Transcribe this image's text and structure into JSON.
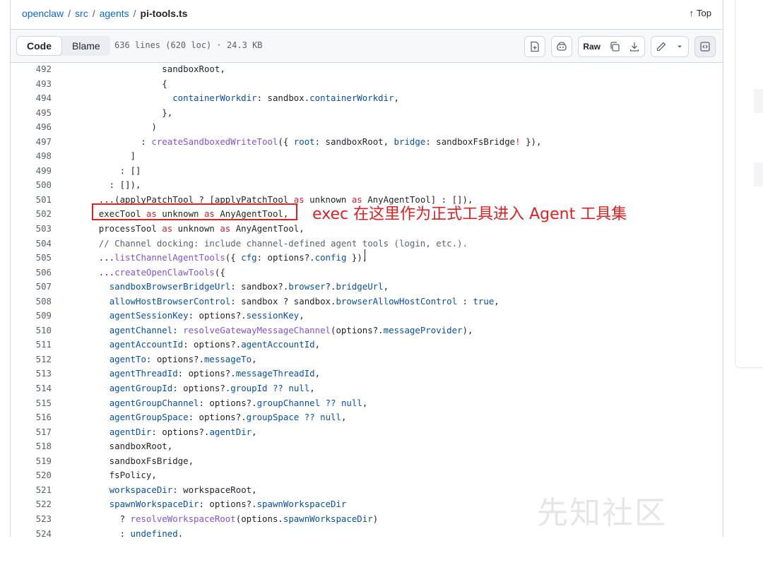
{
  "breadcrumb": {
    "repo": "openclaw",
    "src": "src",
    "agents": "agents",
    "file": "pi-tools.ts",
    "separator": "/"
  },
  "top_link": {
    "arrow": "↑",
    "label": "Top"
  },
  "toolbar": {
    "code_tab": "Code",
    "blame_tab": "Blame",
    "file_info": "636 lines (620 loc) · 24.3 KB",
    "raw_label": "Raw"
  },
  "icons": [
    "file-plus-icon",
    "copilot-icon",
    "copy-icon",
    "download-icon",
    "pencil-icon",
    "chevron-down-icon",
    "symbols-icon",
    "arrow-up-icon"
  ],
  "lines": [
    {
      "n": "492",
      "segs": [
        [
          "t",
          "                  sandboxRoot,"
        ]
      ]
    },
    {
      "n": "493",
      "segs": [
        [
          "t",
          "                  {"
        ]
      ]
    },
    {
      "n": "494",
      "segs": [
        [
          "t",
          "                    "
        ],
        [
          "p",
          "containerWorkdir"
        ],
        [
          "t",
          ": sandbox."
        ],
        [
          "p",
          "containerWorkdir"
        ],
        [
          "t",
          ","
        ]
      ]
    },
    {
      "n": "495",
      "segs": [
        [
          "t",
          "                  },"
        ]
      ]
    },
    {
      "n": "496",
      "segs": [
        [
          "t",
          "                )"
        ]
      ]
    },
    {
      "n": "497",
      "segs": [
        [
          "t",
          "              : "
        ],
        [
          "f",
          "createSandboxedWriteTool"
        ],
        [
          "t",
          "({ "
        ],
        [
          "p",
          "root"
        ],
        [
          "t",
          ": sandboxRoot, "
        ],
        [
          "p",
          "bridge"
        ],
        [
          "t",
          ": sandboxFsBridge"
        ],
        [
          "k",
          "!"
        ],
        [
          "t",
          " }),"
        ]
      ]
    },
    {
      "n": "498",
      "segs": [
        [
          "t",
          "            ]"
        ]
      ]
    },
    {
      "n": "499",
      "segs": [
        [
          "t",
          "          : []"
        ]
      ]
    },
    {
      "n": "500",
      "segs": [
        [
          "t",
          "        : []),"
        ]
      ]
    },
    {
      "n": "501",
      "segs": [
        [
          "t",
          "      ...(applyPatchTool ? [applyPatchTool "
        ],
        [
          "k",
          "as"
        ],
        [
          "t",
          " unknown "
        ],
        [
          "k",
          "as"
        ],
        [
          "t",
          " AnyAgentTool] : []),"
        ]
      ]
    },
    {
      "n": "502",
      "segs": [
        [
          "t",
          "      execTool "
        ],
        [
          "k",
          "as"
        ],
        [
          "t",
          " unknown "
        ],
        [
          "k",
          "as"
        ],
        [
          "t",
          " AnyAgentTool,"
        ]
      ]
    },
    {
      "n": "503",
      "segs": [
        [
          "t",
          "      processTool "
        ],
        [
          "k",
          "as"
        ],
        [
          "t",
          " unknown "
        ],
        [
          "k",
          "as"
        ],
        [
          "t",
          " AnyAgentTool,"
        ]
      ]
    },
    {
      "n": "504",
      "segs": [
        [
          "c",
          "      // Channel docking: include channel-defined agent tools (login, etc.)."
        ]
      ]
    },
    {
      "n": "505",
      "segs": [
        [
          "t",
          "      ..."
        ],
        [
          "f",
          "listChannelAgentTools"
        ],
        [
          "t",
          "({ "
        ],
        [
          "p",
          "cfg"
        ],
        [
          "t",
          ": options?."
        ],
        [
          "p",
          "config"
        ],
        [
          "t",
          " }),"
        ]
      ]
    },
    {
      "n": "506",
      "segs": [
        [
          "t",
          "      ..."
        ],
        [
          "f",
          "createOpenClawTools"
        ],
        [
          "t",
          "({"
        ]
      ]
    },
    {
      "n": "507",
      "segs": [
        [
          "t",
          "        "
        ],
        [
          "p",
          "sandboxBrowserBridgeUrl"
        ],
        [
          "t",
          ": sandbox?."
        ],
        [
          "p",
          "browser"
        ],
        [
          "t",
          "?."
        ],
        [
          "p",
          "bridgeUrl"
        ],
        [
          "t",
          ","
        ]
      ]
    },
    {
      "n": "508",
      "segs": [
        [
          "t",
          "        "
        ],
        [
          "p",
          "allowHostBrowserControl"
        ],
        [
          "t",
          ": sandbox ? sandbox."
        ],
        [
          "p",
          "browserAllowHostControl"
        ],
        [
          "t",
          " : "
        ],
        [
          "p",
          "true"
        ],
        [
          "t",
          ","
        ]
      ]
    },
    {
      "n": "509",
      "segs": [
        [
          "t",
          "        "
        ],
        [
          "p",
          "agentSessionKey"
        ],
        [
          "t",
          ": options?."
        ],
        [
          "p",
          "sessionKey"
        ],
        [
          "t",
          ","
        ]
      ]
    },
    {
      "n": "510",
      "segs": [
        [
          "t",
          "        "
        ],
        [
          "p",
          "agentChannel"
        ],
        [
          "t",
          ": "
        ],
        [
          "f",
          "resolveGatewayMessageChannel"
        ],
        [
          "t",
          "(options?."
        ],
        [
          "p",
          "messageProvider"
        ],
        [
          "t",
          "),"
        ]
      ]
    },
    {
      "n": "511",
      "segs": [
        [
          "t",
          "        "
        ],
        [
          "p",
          "agentAccountId"
        ],
        [
          "t",
          ": options?."
        ],
        [
          "p",
          "agentAccountId"
        ],
        [
          "t",
          ","
        ]
      ]
    },
    {
      "n": "512",
      "segs": [
        [
          "t",
          "        "
        ],
        [
          "p",
          "agentTo"
        ],
        [
          "t",
          ": options?."
        ],
        [
          "p",
          "messageTo"
        ],
        [
          "t",
          ","
        ]
      ]
    },
    {
      "n": "513",
      "segs": [
        [
          "t",
          "        "
        ],
        [
          "p",
          "agentThreadId"
        ],
        [
          "t",
          ": options?."
        ],
        [
          "p",
          "messageThreadId"
        ],
        [
          "t",
          ","
        ]
      ]
    },
    {
      "n": "514",
      "segs": [
        [
          "t",
          "        "
        ],
        [
          "p",
          "agentGroupId"
        ],
        [
          "t",
          ": options?."
        ],
        [
          "p",
          "groupId"
        ],
        [
          "t",
          " "
        ],
        [
          "p",
          "??"
        ],
        [
          "t",
          " "
        ],
        [
          "p",
          "null"
        ],
        [
          "t",
          ","
        ]
      ]
    },
    {
      "n": "515",
      "segs": [
        [
          "t",
          "        "
        ],
        [
          "p",
          "agentGroupChannel"
        ],
        [
          "t",
          ": options?."
        ],
        [
          "p",
          "groupChannel"
        ],
        [
          "t",
          " "
        ],
        [
          "p",
          "??"
        ],
        [
          "t",
          " "
        ],
        [
          "p",
          "null"
        ],
        [
          "t",
          ","
        ]
      ]
    },
    {
      "n": "516",
      "segs": [
        [
          "t",
          "        "
        ],
        [
          "p",
          "agentGroupSpace"
        ],
        [
          "t",
          ": options?."
        ],
        [
          "p",
          "groupSpace"
        ],
        [
          "t",
          " "
        ],
        [
          "p",
          "??"
        ],
        [
          "t",
          " "
        ],
        [
          "p",
          "null"
        ],
        [
          "t",
          ","
        ]
      ]
    },
    {
      "n": "517",
      "segs": [
        [
          "t",
          "        "
        ],
        [
          "p",
          "agentDir"
        ],
        [
          "t",
          ": options?."
        ],
        [
          "p",
          "agentDir"
        ],
        [
          "t",
          ","
        ]
      ]
    },
    {
      "n": "518",
      "segs": [
        [
          "t",
          "        sandboxRoot,"
        ]
      ]
    },
    {
      "n": "519",
      "segs": [
        [
          "t",
          "        sandboxFsBridge,"
        ]
      ]
    },
    {
      "n": "520",
      "segs": [
        [
          "t",
          "        fsPolicy,"
        ]
      ]
    },
    {
      "n": "521",
      "segs": [
        [
          "t",
          "        "
        ],
        [
          "p",
          "workspaceDir"
        ],
        [
          "t",
          ": workspaceRoot,"
        ]
      ]
    },
    {
      "n": "522",
      "segs": [
        [
          "t",
          "        "
        ],
        [
          "p",
          "spawnWorkspaceDir"
        ],
        [
          "t",
          ": options?."
        ],
        [
          "p",
          "spawnWorkspaceDir"
        ]
      ]
    },
    {
      "n": "523",
      "segs": [
        [
          "t",
          "          ? "
        ],
        [
          "f",
          "resolveWorkspaceRoot"
        ],
        [
          "t",
          "(options."
        ],
        [
          "p",
          "spawnWorkspaceDir"
        ],
        [
          "t",
          ")"
        ]
      ]
    },
    {
      "n": "524",
      "segs": [
        [
          "t",
          "          : "
        ],
        [
          "p",
          "undefined"
        ],
        [
          "t",
          ","
        ]
      ]
    }
  ],
  "annotation": "exec 在这里作为正式工具进入 Agent 工具集",
  "watermark": "先知社区"
}
